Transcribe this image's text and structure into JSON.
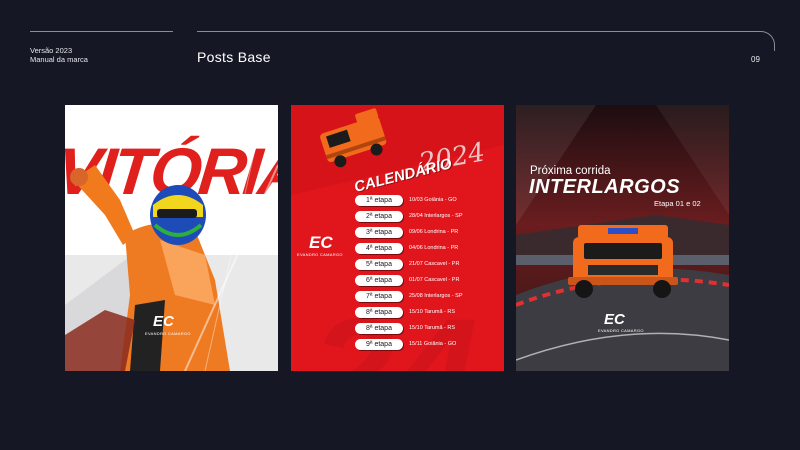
{
  "header": {
    "meta_line1": "Versão 2023",
    "meta_line2": "Manual da marca",
    "section_title": "Posts Base",
    "page_number": "09"
  },
  "posts": [
    {
      "headline": "VITÓRIA",
      "logo": "EC",
      "logo_subtitle": "EVANDRO CAMARGO"
    },
    {
      "title": "CALENDÁRIO",
      "year": "2024",
      "logo": "EC",
      "logo_subtitle": "EVANDRO CAMARGO",
      "stages": [
        {
          "label": "1ª etapa",
          "info": "10/03 Goiânia - GO"
        },
        {
          "label": "2ª etapa",
          "info": "28/04 Interlargos - SP"
        },
        {
          "label": "3ª etapa",
          "info": "09/06 Londrina - PR"
        },
        {
          "label": "4ª etapa",
          "info": "04/06 Londrina - PR"
        },
        {
          "label": "5ª etapa",
          "info": "21/07 Cascavel - PR"
        },
        {
          "label": "6ª etapa",
          "info": "01/07 Cascavel - PR"
        },
        {
          "label": "7ª etapa",
          "info": "25/08 Interlargos - SP"
        },
        {
          "label": "8ª etapa",
          "info": "15/10 Tarumã - RS"
        },
        {
          "label": "8ª etapa",
          "info": "15/10 Tarumã - RS"
        },
        {
          "label": "9ª etapa",
          "info": "15/11 Goiânia - GO"
        }
      ]
    },
    {
      "next_race_label": "Próxima corrida",
      "track": "INTERLARGOS",
      "stage_label": "Etapa 01 e 02",
      "logo": "EC",
      "logo_subtitle": "EVANDRO CAMARGO"
    }
  ],
  "colors": {
    "background": "#151824",
    "brand_red": "#e1151c",
    "truck_orange": "#f26a1b"
  }
}
